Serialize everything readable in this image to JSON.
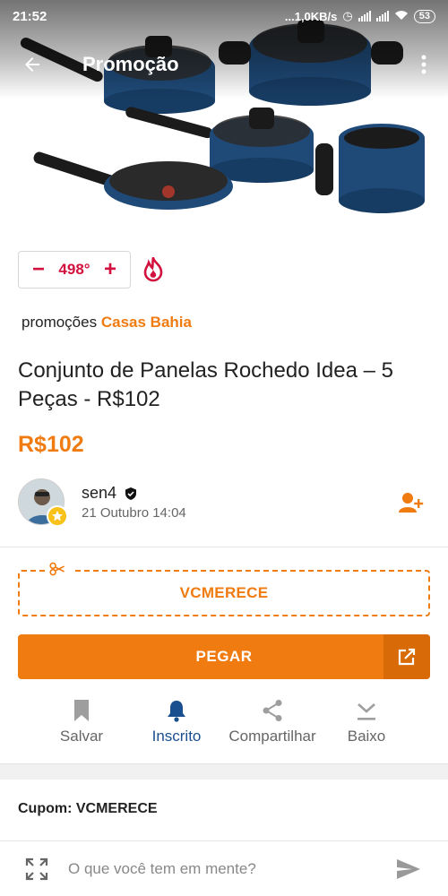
{
  "status_bar": {
    "time": "21:52",
    "network_speed": "...1,0KB/s",
    "battery": "53"
  },
  "app_bar": {
    "title": "Promoção",
    "back_icon": "arrow-left-icon",
    "menu_icon": "more-vert-icon"
  },
  "deal_image": {
    "subject": "cookware-set"
  },
  "vote": {
    "minus": "−",
    "temperature": "498°",
    "plus": "+",
    "hot_icon": "flame-icon"
  },
  "category": {
    "prefix": "promoções",
    "store": "Casas Bahia"
  },
  "deal": {
    "title": "Conjunto de Panelas Rochedo Idea – 5 Peças - R$102",
    "price": "R$102"
  },
  "author": {
    "name": "sen4",
    "verified_icon": "verified-shield-icon",
    "date": "21 Outubro 14:04",
    "follow_icon": "person-add-icon"
  },
  "coupon": {
    "code": "VCMERECE",
    "icon": "scissors-icon"
  },
  "get_deal": {
    "label": "PEGAR",
    "icon": "open-external-icon"
  },
  "actions": [
    {
      "label": "Salvar",
      "icon": "bookmark-icon",
      "active": false
    },
    {
      "label": "Inscrito",
      "icon": "bell-icon",
      "active": true
    },
    {
      "label": "Compartilhar",
      "icon": "share-icon",
      "active": false
    },
    {
      "label": "Baixo",
      "icon": "download-icon",
      "active": false
    }
  ],
  "details": {
    "coupon_line": "Cupom: VCMERECE"
  },
  "comment": {
    "placeholder": "O que você tem em mente?",
    "value": "",
    "expand_icon": "expand-icon",
    "send_icon": "send-icon"
  },
  "colors": {
    "accent": "#f07b10",
    "hot": "#d3113e",
    "active": "#1a4f8f"
  }
}
